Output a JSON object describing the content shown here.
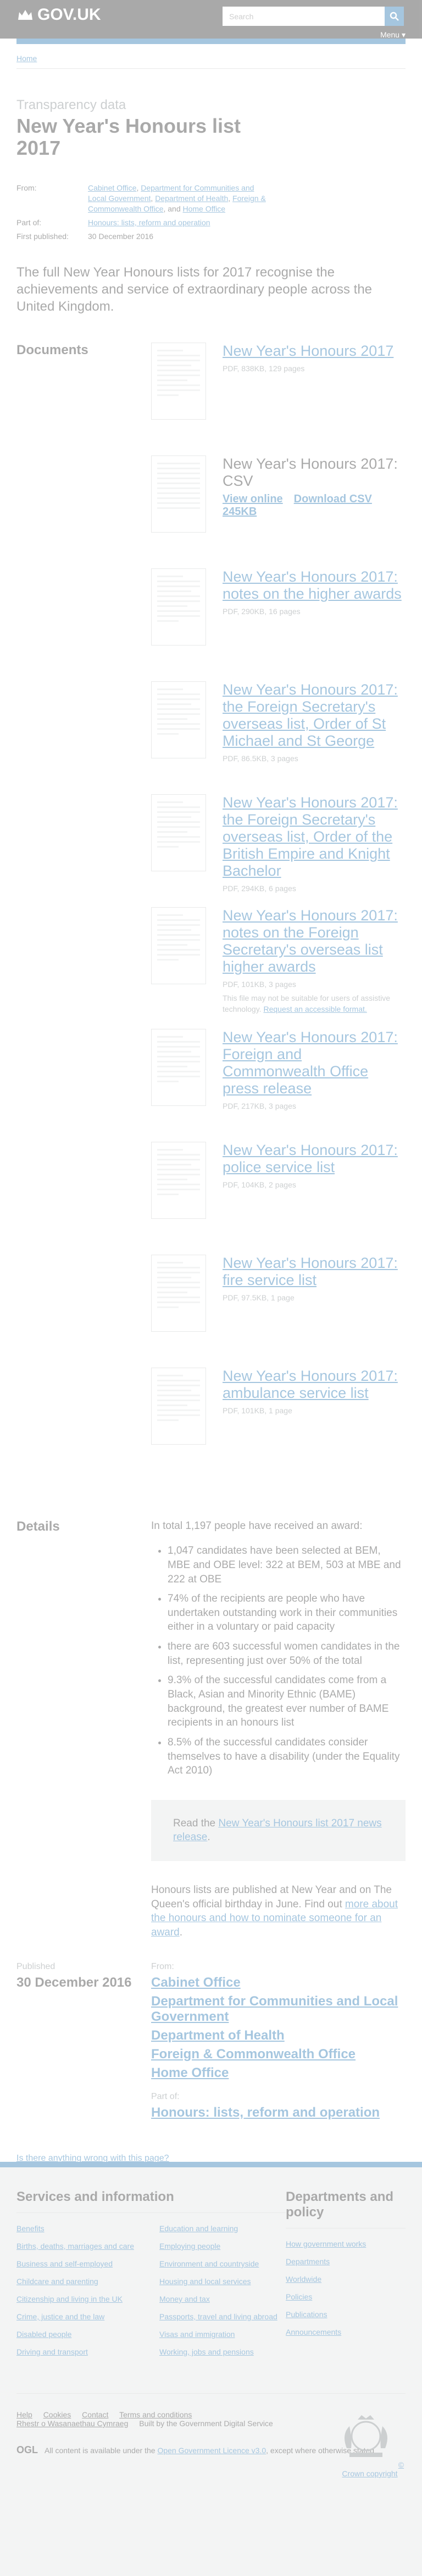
{
  "header": {
    "logo": "GOV.UK",
    "search_placeholder": "Search",
    "menu": "Menu ▾"
  },
  "breadcrumb": [
    "Home"
  ],
  "title": {
    "context": "Transparency data",
    "heading": "New Year's Honours list 2017"
  },
  "metadata": {
    "from_label": "From:",
    "from_orgs": [
      "Cabinet Office",
      "Department for Communities and Local Government",
      "Department of Health",
      "Foreign & Commonwealth Office",
      "Home Office"
    ],
    "partof_label": "Part of:",
    "partof": "Honours: lists, reform and operation",
    "published_label": "First published:",
    "published": "30 December 2016"
  },
  "description": "The full New Year Honours lists for 2017 recognise the achievements and service of extraordinary people across the United Kingdom.",
  "documents": {
    "heading": "Documents",
    "items": [
      {
        "title": "New Year's Honours 2017",
        "meta": "PDF, 838KB, 129 pages"
      },
      {
        "title": "New Year's Honours 2017: CSV",
        "links": [
          "View online",
          "Download CSV"
        ],
        "size": "245KB"
      },
      {
        "title": "New Year's Honours 2017: notes on the higher awards",
        "meta": "PDF, 290KB, 16 pages"
      },
      {
        "title": "New Year's Honours 2017: the Foreign Secretary's overseas list, Order of St Michael and St George",
        "meta": "PDF, 86.5KB, 3 pages"
      },
      {
        "title": "New Year's Honours 2017: the Foreign Secretary's overseas list, Order of the British Empire and Knight Bachelor",
        "meta": "PDF, 294KB, 6 pages"
      },
      {
        "title": "New Year's Honours 2017: notes on the Foreign Secretary's overseas list higher awards",
        "meta": "PDF, 101KB, 3 pages",
        "warning": "This file may not be suitable for users of assistive technology.",
        "warning_link": "Request an accessible format."
      },
      {
        "title": "New Year's Honours 2017: Foreign and Commonwealth Office press release",
        "meta": "PDF, 217KB, 3 pages"
      },
      {
        "title": "New Year's Honours 2017: police service list",
        "meta": "PDF, 104KB, 2 pages"
      },
      {
        "title": "New Year's Honours 2017: fire service list",
        "meta": "PDF, 97.5KB, 1 page"
      },
      {
        "title": "New Year's Honours 2017: ambulance service list",
        "meta": "PDF, 101KB, 1 page"
      }
    ]
  },
  "details": {
    "heading": "Details",
    "intro": "In total 1,197 people have received an award:",
    "bullets": [
      "1,047 candidates have been selected at BEM, MBE and OBE level: 322 at BEM, 503 at MBE and 222 at OBE",
      "74% of the recipients are people who have undertaken outstanding work in their communities either in a voluntary or paid capacity",
      "there are 603 successful women candidates in the list, representing just over 50% of the total",
      "9.3% of the successful candidates come from a Black, Asian and Minority Ethnic (BAME) background, the greatest ever number of BAME recipients in an honours list",
      "8.5% of the successful candidates consider themselves to have a disability (under the Equality Act 2010)"
    ],
    "callout_prefix": "Read the",
    "callout_link": "New Year's Honours list 2017 news release",
    "callout_suffix": ".",
    "outro_text": "Honours lists are published at New Year and on The Queen's official birthday in June. Find out",
    "outro_link": "more about the honours and how to nominate someone for an award",
    "outro_end": "."
  },
  "published": {
    "label": "Published",
    "date": "30 December 2016",
    "from_label": "From:",
    "partof_label": "Part of:"
  },
  "feedback": "Is there anything wrong with this page?",
  "footer": {
    "services_heading": "Services and information",
    "services": [
      "Benefits",
      "Education and learning",
      "Births, deaths, marriages and care",
      "Employing people",
      "Business and self-employed",
      "Environment and countryside",
      "Childcare and parenting",
      "Housing and local services",
      "Citizenship and living in the UK",
      "Money and tax",
      "Crime, justice and the law",
      "Passports, travel and living abroad",
      "Disabled people",
      "Visas and immigration",
      "Driving and transport",
      "Working, jobs and pensions"
    ],
    "departments_heading": "Departments and policy",
    "departments": [
      "How government works",
      "Departments",
      "Worldwide",
      "Policies",
      "Publications",
      "Announcements"
    ],
    "support_links": [
      "Help",
      "Cookies",
      "Contact",
      "Terms and conditions",
      "Rhestr o Wasanaethau Cymraeg",
      "Built by the Government Digital Service"
    ],
    "ogl_mark": "OGL",
    "licence_prefix": "All content is available under the",
    "licence_link": "Open Government Licence v3.0",
    "licence_suffix": ", except where otherwise stated",
    "copyright": "© Crown copyright"
  }
}
